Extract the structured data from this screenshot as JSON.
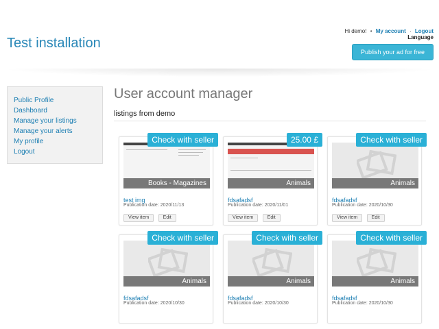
{
  "header": {
    "site_title": "Test installation",
    "greeting": "Hi demo!",
    "bullet": "•",
    "my_account": "My account",
    "separator": "·",
    "logout": "Logout",
    "language": "Language",
    "publish_label": "Publish your ad for free"
  },
  "sidebar": {
    "items": [
      {
        "label": "Public Profile"
      },
      {
        "label": "Dashboard"
      },
      {
        "label": "Manage your listings"
      },
      {
        "label": "Manage your alerts"
      },
      {
        "label": "My profile"
      },
      {
        "label": "Logout"
      }
    ]
  },
  "main": {
    "title": "User account manager",
    "subtitle": "listings from demo"
  },
  "listings": [
    {
      "badge": "Check with seller",
      "category": "Books - Magazines",
      "title": "test img",
      "date": "Publication date: 2020/11/13",
      "view": "View item",
      "edit": "Edit"
    },
    {
      "badge": "25.00 £",
      "category": "Animals",
      "title": "fdsafadsf",
      "date": "Publication date: 2020/11/01",
      "view": "View item",
      "edit": "Edit"
    },
    {
      "badge": "Check with seller",
      "category": "Animals",
      "title": "fdsafadsf",
      "date": "Publication date: 2020/10/30",
      "view": "View item",
      "edit": "Edit"
    },
    {
      "badge": "Check with seller",
      "category": "Animals",
      "title": "fdsafadsf",
      "date": "Publication date: 2020/10/30"
    },
    {
      "badge": "Check with seller",
      "category": "Animals",
      "title": "fdsafadsf",
      "date": "Publication date: 2020/10/30"
    },
    {
      "badge": "Check with seller",
      "category": "Animals",
      "title": "fdsafadsf",
      "date": "Publication date: 2020/10/30"
    }
  ],
  "colors": {
    "accent": "#2a88b8",
    "badge": "#2ab0d6",
    "link": "#1d7fb3"
  },
  "icons": {
    "placeholder": "image-placeholder-icon"
  }
}
